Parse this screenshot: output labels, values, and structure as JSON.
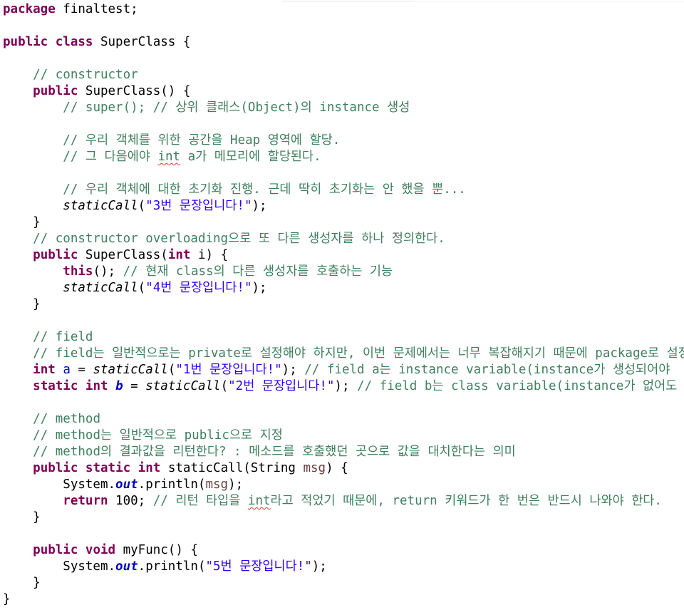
{
  "code": {
    "l1": [
      "package",
      " finaltest;"
    ],
    "l3": [
      "public",
      " ",
      "class",
      " SuperClass {"
    ],
    "l5": [
      "    ",
      "// constructor"
    ],
    "l6": [
      "    ",
      "public",
      " SuperClass() {"
    ],
    "l7": [
      "        ",
      "// super(); // 상위 클래스(Object)의 instance 생성"
    ],
    "l9": [
      "        ",
      "// 우리 객체를 위한 공간을 Heap 영역에 할당."
    ],
    "l10": [
      "        ",
      "// 그 다음에야 ",
      "int",
      " a가 메모리에 할당된다."
    ],
    "l12": [
      "        ",
      "// 우리 객체에 대한 초기화 진행. 근데 딱히 초기화는 안 했을 뿐..."
    ],
    "l13": [
      "        ",
      "staticCall",
      "(",
      "\"3번 문장입니다!\"",
      ");"
    ],
    "l14": [
      "    }"
    ],
    "l15": [
      "    ",
      "// constructor overloading으로 또 다른 생성자를 하나 정의한다."
    ],
    "l16": [
      "    ",
      "public",
      " SuperClass(",
      "int",
      " i) {"
    ],
    "l17": [
      "        ",
      "this",
      "(); ",
      "// 현재 class의 다른 생성자를 호출하는 기능"
    ],
    "l18": [
      "        ",
      "staticCall",
      "(",
      "\"4번 문장입니다!\"",
      ");"
    ],
    "l19": [
      "    }"
    ],
    "l21": [
      "    ",
      "// field"
    ],
    "l22": [
      "    ",
      "// field는 일반적으로는 private로 설정해야 하지만, 이번 문제에서는 너무 복잡해지기 때문에 package로 설정하"
    ],
    "l23": [
      "    ",
      "int",
      " ",
      "a",
      " = ",
      "staticCall",
      "(",
      "\"1번 문장입니다!\"",
      "); ",
      "// field a는 instance variable(instance가 생성되어야"
    ],
    "l24": [
      "    ",
      "static",
      " ",
      "int",
      " ",
      "b",
      " = ",
      "staticCall",
      "(",
      "\"2번 문장입니다!\"",
      "); ",
      "// field b는 class variable(instance가 없어도"
    ],
    "l26": [
      "    ",
      "// method"
    ],
    "l27": [
      "    ",
      "// method는 일반적으로 public으로 지정"
    ],
    "l28": [
      "    ",
      "// method의 결과값을 리턴한다? : 메소드를 호출했던 곳으로 값을 대치한다는 의미"
    ],
    "l29": [
      "    ",
      "public",
      " ",
      "static",
      " ",
      "int",
      " staticCall(String ",
      "msg",
      ") {"
    ],
    "l30": [
      "        System.",
      "out",
      ".println(",
      "msg",
      ");"
    ],
    "l31": [
      "        ",
      "return",
      " 100; ",
      "// 리턴 타입을 ",
      "int",
      "라고 적었기 때문에, return 키워드가 한 번은 반드시 나와야 한다."
    ],
    "l32": [
      "    }"
    ],
    "l34": [
      "    ",
      "public",
      " ",
      "void",
      " myFunc() {"
    ],
    "l35": [
      "        System.",
      "out",
      ".println(",
      "\"5번 문장입니다!\"",
      ");"
    ],
    "l36": [
      "    }"
    ],
    "l37": [
      "}"
    ]
  }
}
